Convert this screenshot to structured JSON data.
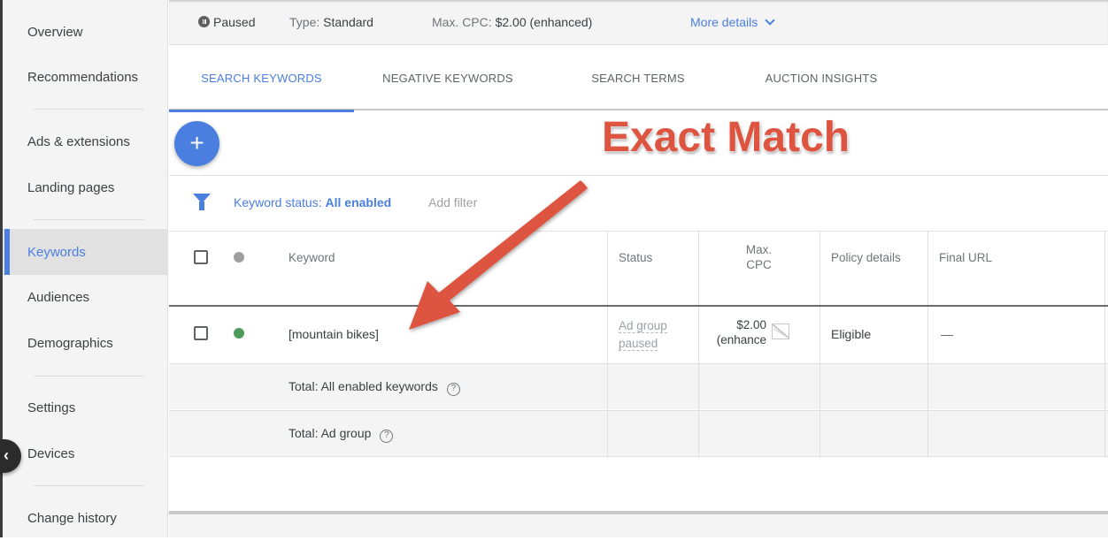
{
  "sidebar": {
    "items": [
      {
        "label": "Overview",
        "active": false
      },
      {
        "label": "Recommendations",
        "active": false
      },
      {
        "label": "Ads & extensions",
        "active": false
      },
      {
        "label": "Landing pages",
        "active": false
      },
      {
        "label": "Keywords",
        "active": true
      },
      {
        "label": "Audiences",
        "active": false
      },
      {
        "label": "Demographics",
        "active": false
      },
      {
        "label": "Settings",
        "active": false
      },
      {
        "label": "Devices",
        "active": false
      },
      {
        "label": "Change history",
        "active": false
      }
    ],
    "collapse_icon": "chevron-left-icon"
  },
  "infobar": {
    "status": "Paused",
    "status_icon": "pause-circle-icon",
    "type_label": "Type:",
    "type_value": "Standard",
    "cpc_label": "Max. CPC:",
    "cpc_value": "$2.00 (enhanced)",
    "more_details": "More details"
  },
  "tabs": [
    {
      "label": "SEARCH KEYWORDS",
      "active": true
    },
    {
      "label": "NEGATIVE KEYWORDS",
      "active": false
    },
    {
      "label": "SEARCH TERMS",
      "active": false
    },
    {
      "label": "AUCTION INSIGHTS",
      "active": false
    }
  ],
  "add_button": "+",
  "annotation": {
    "title": "Exact Match",
    "color": "#dd5440"
  },
  "filter": {
    "label": "Keyword status:",
    "value": "All enabled",
    "add_filter": "Add filter"
  },
  "table": {
    "headers": {
      "keyword": "Keyword",
      "status": "Status",
      "max_cpc_line1": "Max.",
      "max_cpc_line2": "CPC",
      "policy": "Policy details",
      "final_url": "Final URL"
    },
    "rows": [
      {
        "keyword": "[mountain bikes]",
        "status_line1": "Ad group",
        "status_line2": "paused",
        "max_cpc_line1": "$2.00",
        "max_cpc_line2": "(enhance",
        "policy": "Eligible",
        "final_url": "—",
        "status_dot_color": "#4e9a5a"
      }
    ],
    "totals": [
      {
        "label": "Total: All enabled keywords"
      },
      {
        "label": "Total: Ad group"
      }
    ],
    "help_glyph": "?"
  },
  "colors": {
    "accent": "#4a7fdf",
    "header_dot": "#9e9e9e",
    "enabled_dot": "#4e9a5a"
  }
}
